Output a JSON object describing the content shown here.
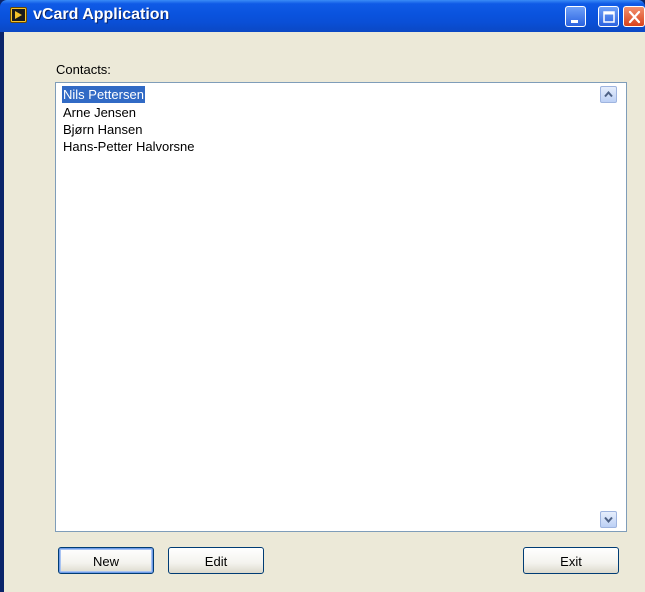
{
  "window": {
    "title": "vCard Application",
    "colors": {
      "titlebar": "#0a53de",
      "client_bg": "#ece9d8",
      "selection": "#316ac5",
      "close_button": "#d8421c"
    }
  },
  "contacts": {
    "label": "Contacts:",
    "items": [
      {
        "name": "Nils Pettersen",
        "selected": true
      },
      {
        "name": "Arne Jensen",
        "selected": false
      },
      {
        "name": "Bjørn Hansen",
        "selected": false
      },
      {
        "name": "Hans-Petter Halvorsne",
        "selected": false
      }
    ]
  },
  "buttons": {
    "new_label": "New",
    "edit_label": "Edit",
    "exit_label": "Exit"
  },
  "icons": {
    "app": "labview-icon",
    "minimize": "minimize-icon",
    "maximize": "maximize-icon",
    "close": "close-icon",
    "scroll_up": "scroll-up-arrow-icon",
    "scroll_down": "scroll-down-arrow-icon"
  }
}
